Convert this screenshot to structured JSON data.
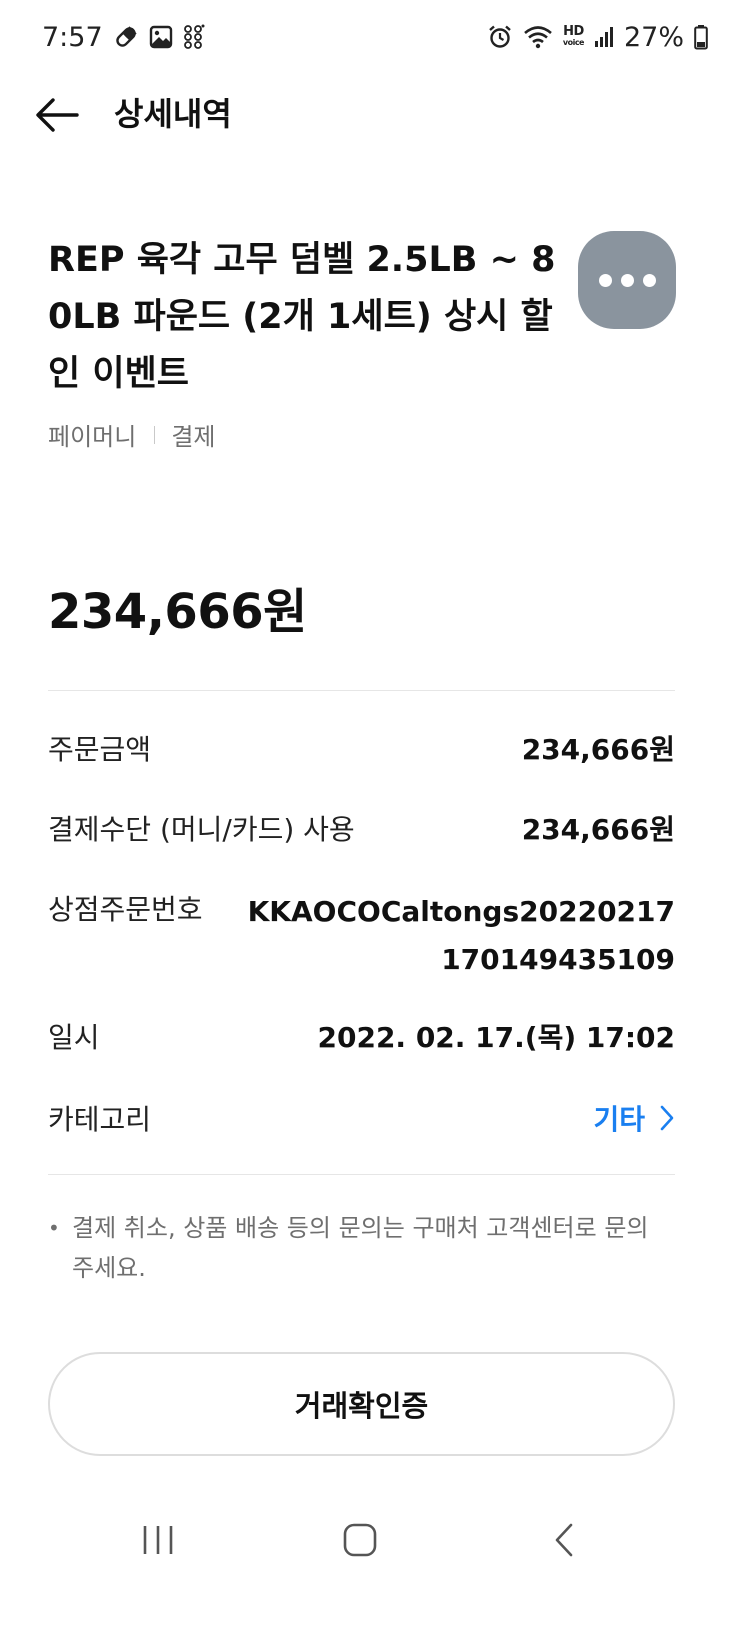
{
  "status_bar": {
    "time": "7:57",
    "battery": "27%",
    "hd_line1": "HD",
    "hd_line2": "voice",
    "left_icons": [
      "pill-icon",
      "image-icon",
      "dots-icon"
    ],
    "right_icons": [
      "alarm-icon",
      "wifi-icon",
      "hd-voice-icon",
      "signal-icon",
      "battery-icon"
    ]
  },
  "header": {
    "title": "상세내역"
  },
  "product": {
    "title": "REP 육각 고무 덤벨 2.5LB ~ 80LB 파운드 (2개 1세트) 상시 할인 이벤트",
    "source": "페이머니",
    "type": "결제"
  },
  "amount": "234,666원",
  "details": {
    "order_amount_label": "주문금액",
    "order_amount_value": "234,666원",
    "payment_method_label": "결제수단 (머니/카드) 사용",
    "payment_method_value": "234,666원",
    "order_number_label": "상점주문번호",
    "order_number_value": "KKAOCOCaltongs20220217170149435109",
    "datetime_label": "일시",
    "datetime_value": "2022. 02. 17.(목) 17:02",
    "category_label": "카테고리",
    "category_value": "기타"
  },
  "notice": "결제 취소, 상품 배송 등의 문의는 구매처 고객센터로 문의 주세요.",
  "confirm_button": "거래확인증",
  "colors": {
    "accent": "#1a7ff0",
    "more_button_bg": "#8a949e",
    "muted_text": "#6f6f6f"
  }
}
